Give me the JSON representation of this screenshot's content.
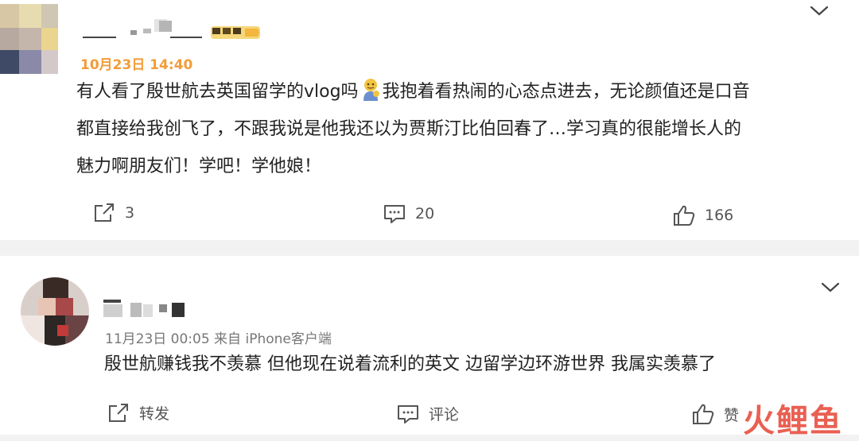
{
  "posts": [
    {
      "timestamp": "10月23日 14:40",
      "lines": [
        "有人看了殷世航去英国留学的vlog吗",
        "我抱着看热闹的心态点进去，无论颜值还是口音",
        "都直接给我创飞了，不跟我说是他我还以为贾斯汀比伯回春了…学习真的很能增长人的",
        "魅力啊朋友们！学吧！学他娘！"
      ],
      "emoji_icon": "ok-gesture-emoji",
      "actions": {
        "repost": "3",
        "comment": "20",
        "like": "166"
      }
    },
    {
      "timestamp": "11月23日 00:05  来自 iPhone客户端",
      "text": "殷世航赚钱我不羡慕 但他现在说着流利的英文 边留学边环游世界 我属实羡慕了",
      "actions": {
        "repost": "转发",
        "comment": "评论",
        "like": "赞"
      }
    }
  ],
  "watermark": "火鲤鱼",
  "colors": {
    "accent_time": "#f29c38",
    "watermark": "#e8584a"
  }
}
